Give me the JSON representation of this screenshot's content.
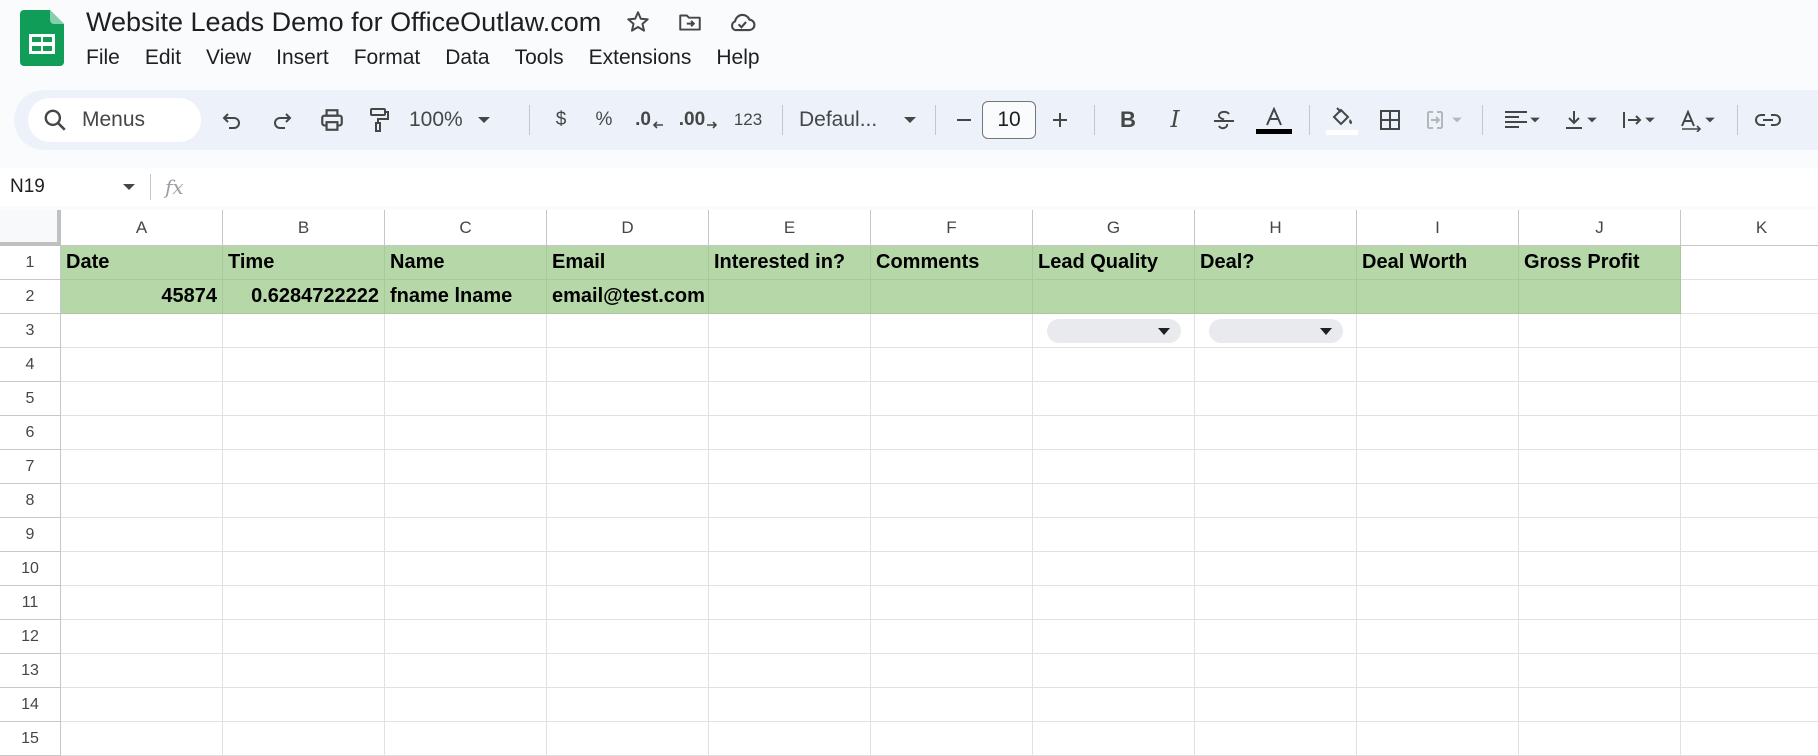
{
  "doc": {
    "title": "Website Leads Demo for OfficeOutlaw.com"
  },
  "menu": [
    "File",
    "Edit",
    "View",
    "Insert",
    "Format",
    "Data",
    "Tools",
    "Extensions",
    "Help"
  ],
  "toolbar": {
    "search_label": "Menus",
    "zoom": "100%",
    "currency": "$",
    "percent": "%",
    "decrease_decimal": ".0",
    "increase_decimal": ".00",
    "number_format": "123",
    "font": "Defaul...",
    "font_size": "10",
    "bold": "B",
    "italic": "I"
  },
  "formula_bar": {
    "name_box": "N19",
    "fx": "fx"
  },
  "grid": {
    "columns": [
      "A",
      "B",
      "C",
      "D",
      "E",
      "F",
      "G",
      "H",
      "I",
      "J",
      "K"
    ],
    "rows": [
      "1",
      "2",
      "3",
      "4",
      "5",
      "6",
      "7",
      "8",
      "9",
      "10",
      "11",
      "12",
      "13",
      "14",
      "15"
    ],
    "header_row": [
      "Date",
      "Time",
      "Name",
      "Email",
      "Interested in?",
      "Comments",
      "Lead Quality",
      "Deal?",
      "Deal Worth",
      "Gross Profit"
    ],
    "data_row": [
      "45874",
      "0.6284722222",
      "fname lname",
      "email@test.com",
      "",
      "",
      "",
      "",
      "",
      ""
    ]
  },
  "colors": {
    "header_fill": "#b6d7a8",
    "sheets_green": "#0f9d58"
  }
}
